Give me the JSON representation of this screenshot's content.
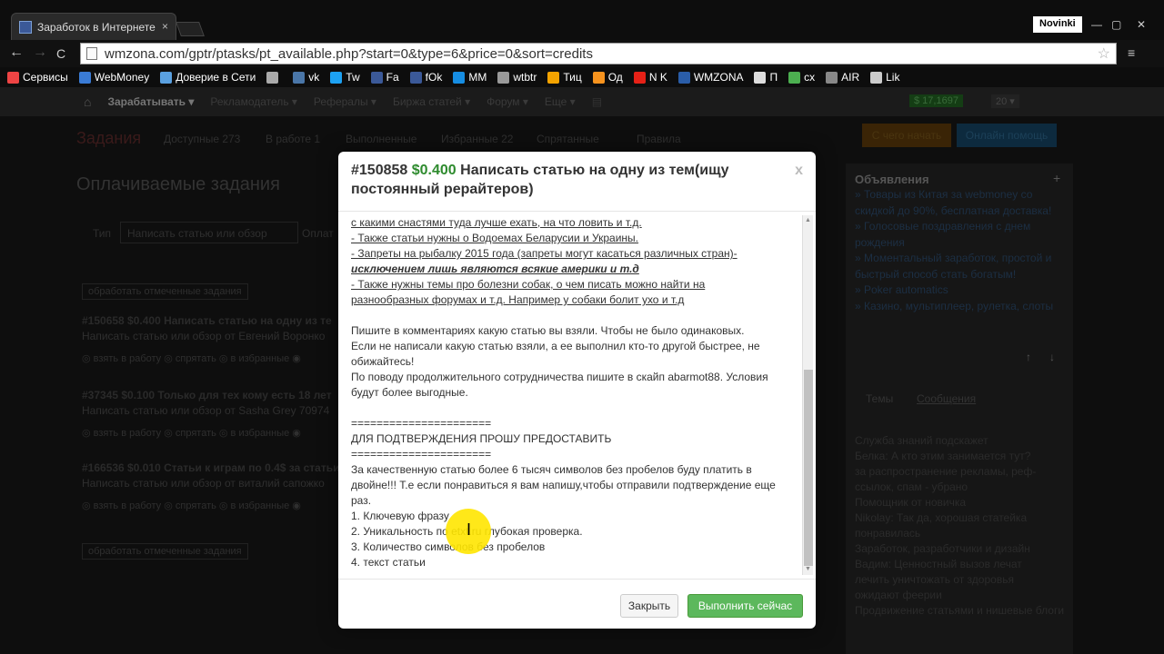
{
  "browser": {
    "tab_title": "Заработок в Интернете",
    "tab_close": "×",
    "profile": "Novinki",
    "url": "wmzona.com/gptr/ptasks/pt_available.php?start=0&type=6&price=0&sort=credits",
    "star_icon": "☆",
    "back_icon": "←",
    "forward_icon": "→",
    "reload_icon": "C",
    "menu_icon": "≡",
    "minimize_icon": "—",
    "maximize_icon": "▢",
    "close_icon": "✕",
    "bookmarks": [
      {
        "label": "Сервисы",
        "color": "#e44"
      },
      {
        "label": "WebMoney",
        "color": "#3a7bd5"
      },
      {
        "label": "Доверие в Сети",
        "color": "#5aa0e0"
      },
      {
        "label": "",
        "color": "#aaa"
      },
      {
        "label": "vk",
        "color": "#4a76a8"
      },
      {
        "label": "Tw",
        "color": "#1da1f2"
      },
      {
        "label": "Fa",
        "color": "#3b5998"
      },
      {
        "label": "fOk",
        "color": "#3b5998"
      },
      {
        "label": "MM",
        "color": "#168de2"
      },
      {
        "label": "wtbtr",
        "color": "#999"
      },
      {
        "label": "Тиц",
        "color": "#f4a300"
      },
      {
        "label": "Од",
        "color": "#f7931e"
      },
      {
        "label": "N K",
        "color": "#e62117"
      },
      {
        "label": "WMZONA",
        "color": "#2a5da8"
      },
      {
        "label": "П",
        "color": "#ddd"
      },
      {
        "label": "cx",
        "color": "#4caf50"
      },
      {
        "label": "AIR",
        "color": "#888"
      },
      {
        "label": "Lik",
        "color": "#ccc"
      }
    ]
  },
  "site": {
    "home_icon": "⌂",
    "nav": [
      "Зарабатывать ▾",
      "Рекламодатель ▾",
      "Рефералы ▾",
      "Биржа статей ▾",
      "Форум ▾",
      "Еще ▾"
    ],
    "balance": "$ 17,1697",
    "counter": "20 ▾",
    "tabs_title": "Задания",
    "tabs": [
      "Доступные 273",
      "В работе 1",
      "Выполненные",
      "Избранные 22",
      "Спрятанные",
      "Правила"
    ],
    "page_heading": "Оплачиваемые задания",
    "filter_label": "Тип",
    "filter_value": "Написать статью или обзор",
    "filter_label2": "Оплат",
    "process_btn": "обработать отмеченные задания",
    "tasks": [
      {
        "title": "#150658 $0.400 Написать статью на одну из те",
        "sub": "Написать статью или обзор от Евгений Воронко",
        "actions": "◎ взять в работу ◎ спрятать ◎ в избранные ◉"
      },
      {
        "title": "#37345 $0.100 Только для тех кому есть 18 лет",
        "sub": "Написать статью или обзор от Sasha Grey 70974",
        "actions": "◎ взять в работу ◎ спрятать ◎ в избранные ◉"
      },
      {
        "title": "#166536 $0.010 Статьи к играм по 0.4$ за статьи",
        "sub": "Написать статью или обзор от виталий сапожко",
        "actions": "◎ взять в работу ◎ спрятать ◎ в избранные ◉"
      }
    ],
    "right_btn1": "С чего начать",
    "right_btn2": "Онлайн помощь",
    "ads_title": "Объявления",
    "ads": [
      "» Товары из Китая за webmoney со",
      "скидкой до 90%, бесплатная доставка!",
      "» Голосовые поздравления с днем",
      "рождения",
      "» Моментальный заработок, простой и",
      "быстрый способ стать богатым!",
      "» Poker automatics",
      "» Казино, мультиплеер, рулетка, слоты"
    ],
    "side_tabs": [
      "Темы",
      "Сообщения"
    ],
    "messages": [
      "Служба знаний подскажет",
      "Белка: А кто этим занимается тут?",
      "за распространение рекламы, реф-",
      "ссылок, спам - убрано",
      "Помощник от новичка",
      "Nikolay: Так да, хорошая статейка",
      "понравилась",
      "Заработок, разработчики и дизайн",
      "Вадим: Ценностный вызов      лечат",
      "лечить уничтожать      от здоровья",
      "ожидают феерии",
      "Продвижение статьями и нишевые блоги"
    ]
  },
  "modal": {
    "id": "#150858",
    "price": "$0.400",
    "title": "Написать статью на одну из тем(ищу постоянный рерайтеров)",
    "close": "x",
    "lines": [
      {
        "t": "с какими снастями туда лучше ехать, на что ловить и т.д.",
        "s": "u"
      },
      {
        "t": "- Также статьи нужны о Водоемах Беларусии и Украины.",
        "s": "u"
      },
      {
        "t": "- Запреты на рыбалку 2015 года (запреты могут касаться различных стран)-",
        "s": "u"
      },
      {
        "t": "исключением лишь являются всякие америки и т.д",
        "s": "bi"
      },
      {
        "t": "- Также нужны темы про болезни собак, о чем писать можно найти на",
        "s": "u"
      },
      {
        "t": "разнообразных форумах и т.д. Например у собаки болит ухо и т.д",
        "s": "u"
      },
      {
        "t": "",
        "s": "sp"
      },
      {
        "t": "Пишите в комментариях какую статью вы взяли. Чтобы не было одинаковых.",
        "s": ""
      },
      {
        "t": "Если не написали какую статью взяли, а ее выполнил кто-то другой быстрее, не",
        "s": ""
      },
      {
        "t": "обижайтесь!",
        "s": ""
      },
      {
        "t": "По поводу продолжительного сотрудничества пишите в скайп abarmot88. Условия",
        "s": ""
      },
      {
        "t": "будут более выгодные.",
        "s": ""
      },
      {
        "t": "",
        "s": "sp"
      },
      {
        "t": "======================",
        "s": ""
      },
      {
        "t": "ДЛЯ ПОДТВЕРЖДЕНИЯ ПРОШУ ПРЕДОСТАВИТЬ",
        "s": ""
      },
      {
        "t": "======================",
        "s": ""
      },
      {
        "t": "За качественную статью более 6 тысяч символов без пробелов буду платить в",
        "s": ""
      },
      {
        "t": "двойне!!! Т.е если понравиться я вам напишу,чтобы отправили подтверждение еще",
        "s": ""
      },
      {
        "t": "раз.",
        "s": ""
      },
      {
        "t": "1. Ключевую фразу",
        "s": ""
      },
      {
        "t": "2. Уникальность по etxt.ru глубокая проверка.",
        "s": ""
      },
      {
        "t": "3. Количество символов без пробелов",
        "s": ""
      },
      {
        "t": "4. текст статьи",
        "s": ""
      }
    ],
    "close_button": "Закрыть",
    "do_button": "Выполнить сейчас",
    "scroll_up": "▲",
    "scroll_down": "▼"
  }
}
